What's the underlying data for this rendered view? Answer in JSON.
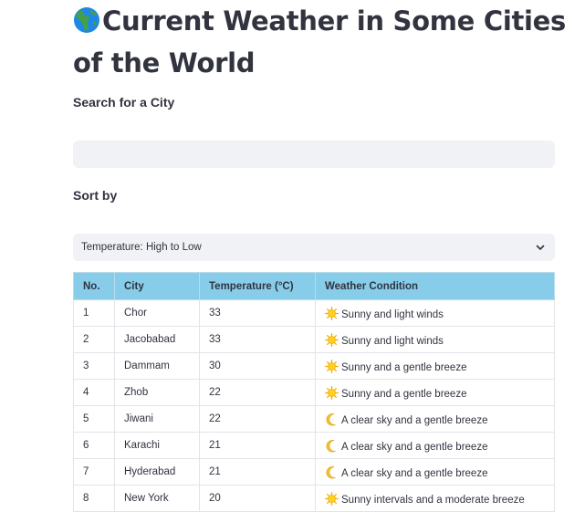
{
  "page": {
    "title": "Current Weather in Some Cities of the World",
    "title_icon": "globe-africa-europe-icon"
  },
  "search": {
    "label": "Search for a City",
    "value": "",
    "placeholder": ""
  },
  "sort": {
    "label": "Sort by",
    "selected": "Temperature: High to Low"
  },
  "table": {
    "header_color": "#87cdea",
    "columns": [
      "No.",
      "City",
      "Temperature (°C)",
      "Weather Condition"
    ],
    "rows": [
      {
        "no": "1",
        "city": "Chor",
        "temp": "33",
        "icon": "sun-icon",
        "condition": "Sunny and light winds"
      },
      {
        "no": "2",
        "city": "Jacobabad",
        "temp": "33",
        "icon": "sun-icon",
        "condition": "Sunny and light winds"
      },
      {
        "no": "3",
        "city": "Dammam",
        "temp": "30",
        "icon": "sun-icon",
        "condition": "Sunny and a gentle breeze"
      },
      {
        "no": "4",
        "city": "Zhob",
        "temp": "22",
        "icon": "sun-icon",
        "condition": "Sunny and a gentle breeze"
      },
      {
        "no": "5",
        "city": "Jiwani",
        "temp": "22",
        "icon": "crescent-moon-icon",
        "condition": "A clear sky and a gentle breeze"
      },
      {
        "no": "6",
        "city": "Karachi",
        "temp": "21",
        "icon": "crescent-moon-icon",
        "condition": "A clear sky and a gentle breeze"
      },
      {
        "no": "7",
        "city": "Hyderabad",
        "temp": "21",
        "icon": "crescent-moon-icon",
        "condition": "A clear sky and a gentle breeze"
      },
      {
        "no": "8",
        "city": "New York",
        "temp": "20",
        "icon": "sun-icon",
        "condition": "Sunny intervals and a moderate breeze"
      }
    ]
  }
}
